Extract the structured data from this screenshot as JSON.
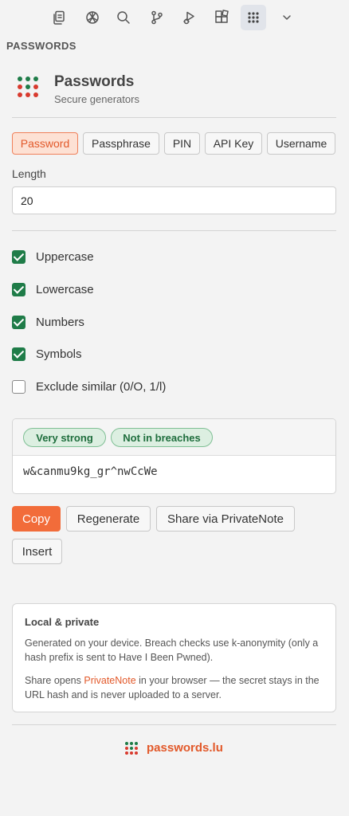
{
  "toolbar": {
    "icons": [
      "files-icon",
      "openai-icon",
      "search-icon",
      "source-control-icon",
      "run-debug-icon",
      "extensions-icon",
      "grid-icon",
      "chevron-down-icon"
    ]
  },
  "section": {
    "title": "PASSWORDS"
  },
  "app": {
    "title": "Passwords",
    "subtitle": "Secure generators"
  },
  "tabs": [
    {
      "label": "Password",
      "active": true
    },
    {
      "label": "Passphrase",
      "active": false
    },
    {
      "label": "PIN",
      "active": false
    },
    {
      "label": "API Key",
      "active": false
    },
    {
      "label": "Username",
      "active": false
    }
  ],
  "length": {
    "label": "Length",
    "value": "20"
  },
  "options": [
    {
      "label": "Uppercase",
      "checked": true
    },
    {
      "label": "Lowercase",
      "checked": true
    },
    {
      "label": "Numbers",
      "checked": true
    },
    {
      "label": "Symbols",
      "checked": true
    },
    {
      "label": "Exclude similar (0/O, 1/l)",
      "checked": false
    }
  ],
  "result": {
    "badges": [
      "Very strong",
      "Not in breaches"
    ],
    "password": "w&canmu9kg_gr^nwCcWe"
  },
  "actions": {
    "copy": "Copy",
    "regenerate": "Regenerate",
    "share": "Share via PrivateNote",
    "insert": "Insert"
  },
  "info": {
    "title": "Local & private",
    "p1": "Generated on your device. Breach checks use k-anonymity (only a hash prefix is sent to Have I Been Pwned).",
    "p2_before": "Share opens ",
    "p2_link": "PrivateNote",
    "p2_after": " in your browser — the secret stays in the URL hash and is never uploaded to a server."
  },
  "footer": {
    "text": "passwords.lu"
  },
  "colors": {
    "accent": "#f26c3a",
    "check": "#1f7c48",
    "badge_bg": "#dcefe1",
    "dot_green": "#1f7c48",
    "dot_red": "#d83a2e"
  }
}
